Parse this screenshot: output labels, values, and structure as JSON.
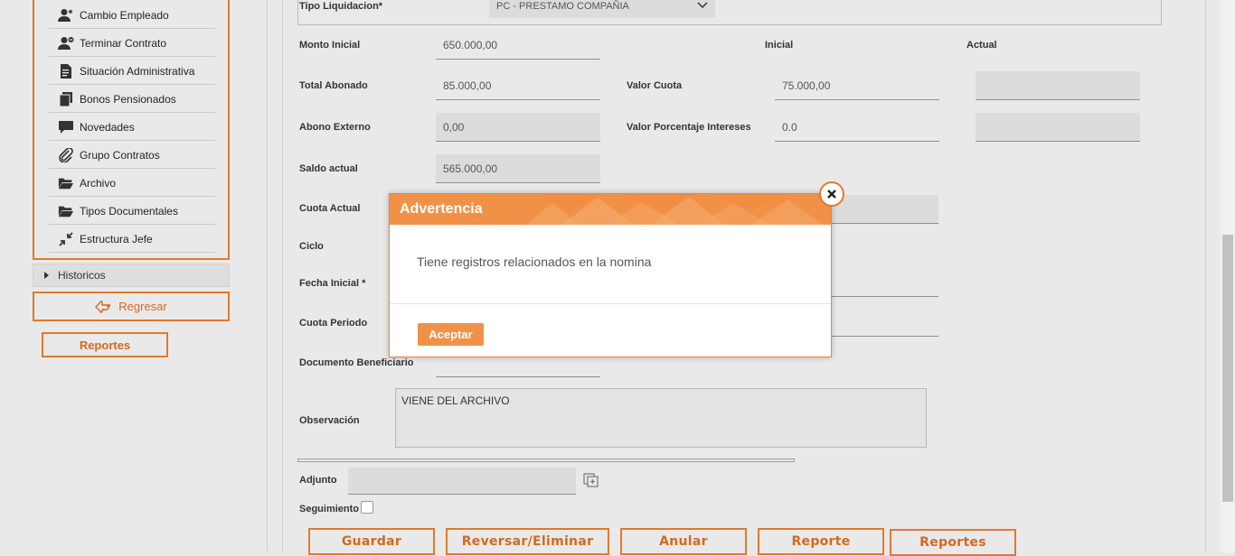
{
  "sidebar": {
    "menu": [
      {
        "label": "Cambio Empleado",
        "icon": "user-star-icon"
      },
      {
        "label": "Terminar Contrato",
        "icon": "user-minus-icon"
      },
      {
        "label": "Situación Administrativa",
        "icon": "document-icon"
      },
      {
        "label": "Bonos Pensionados",
        "icon": "copy-icon"
      },
      {
        "label": "Novedades",
        "icon": "comment-icon"
      },
      {
        "label": "Grupo Contratos",
        "icon": "paperclip-icon"
      },
      {
        "label": "Archivo",
        "icon": "folder-open-icon"
      },
      {
        "label": "Tipos Documentales",
        "icon": "folder-open-icon"
      },
      {
        "label": "Estructura Jefe",
        "icon": "compress-icon"
      }
    ],
    "historicos": "Historicos",
    "regresar": "Regresar",
    "reportes": "Reportes"
  },
  "form": {
    "tipo_liquidacion_label": "Tipo Liquidacion*",
    "tipo_liquidacion_value": "PC - PRESTAMO COMPAÑIA",
    "inicial_header": "Inicial",
    "actual_header": "Actual",
    "monto_inicial_label": "Monto Inicial",
    "monto_inicial": "650.000,00",
    "total_abonado_label": "Total Abonado",
    "total_abonado": "85.000,00",
    "valor_cuota_label": "Valor Cuota",
    "valor_cuota": "75.000,00",
    "abono_externo_label": "Abono Externo",
    "abono_externo": "0,00",
    "valor_porcentaje_label": "Valor Porcentaje Intereses",
    "valor_porcentaje": "0.0",
    "saldo_actual_label": "Saldo actual",
    "saldo_actual": "565.000,00",
    "cuota_actual_label": "Cuota Actual",
    "ciclo_label": "Ciclo",
    "fecha_inicial_label": "Fecha Inicial *",
    "cuota_periodo_label": "Cuota Periodo",
    "documento_beneficiario_label": "Documento Beneficiario",
    "observacion_label": "Observación",
    "observacion": "VIENE DEL ARCHIVO",
    "adjunto_label": "Adjunto",
    "seguimiento_label": "Seguimiento"
  },
  "buttons": {
    "guardar": "Guardar",
    "reversar": "Reversar/Eliminar",
    "anular": "Anular",
    "reporte": "Reporte",
    "reportes": "Reportes"
  },
  "modal": {
    "title": "Advertencia",
    "message": "Tiene registros relacionados en la nomina",
    "accept": "Aceptar"
  },
  "colors": {
    "accent": "#e07a2c",
    "modal_header": "#f19147"
  }
}
